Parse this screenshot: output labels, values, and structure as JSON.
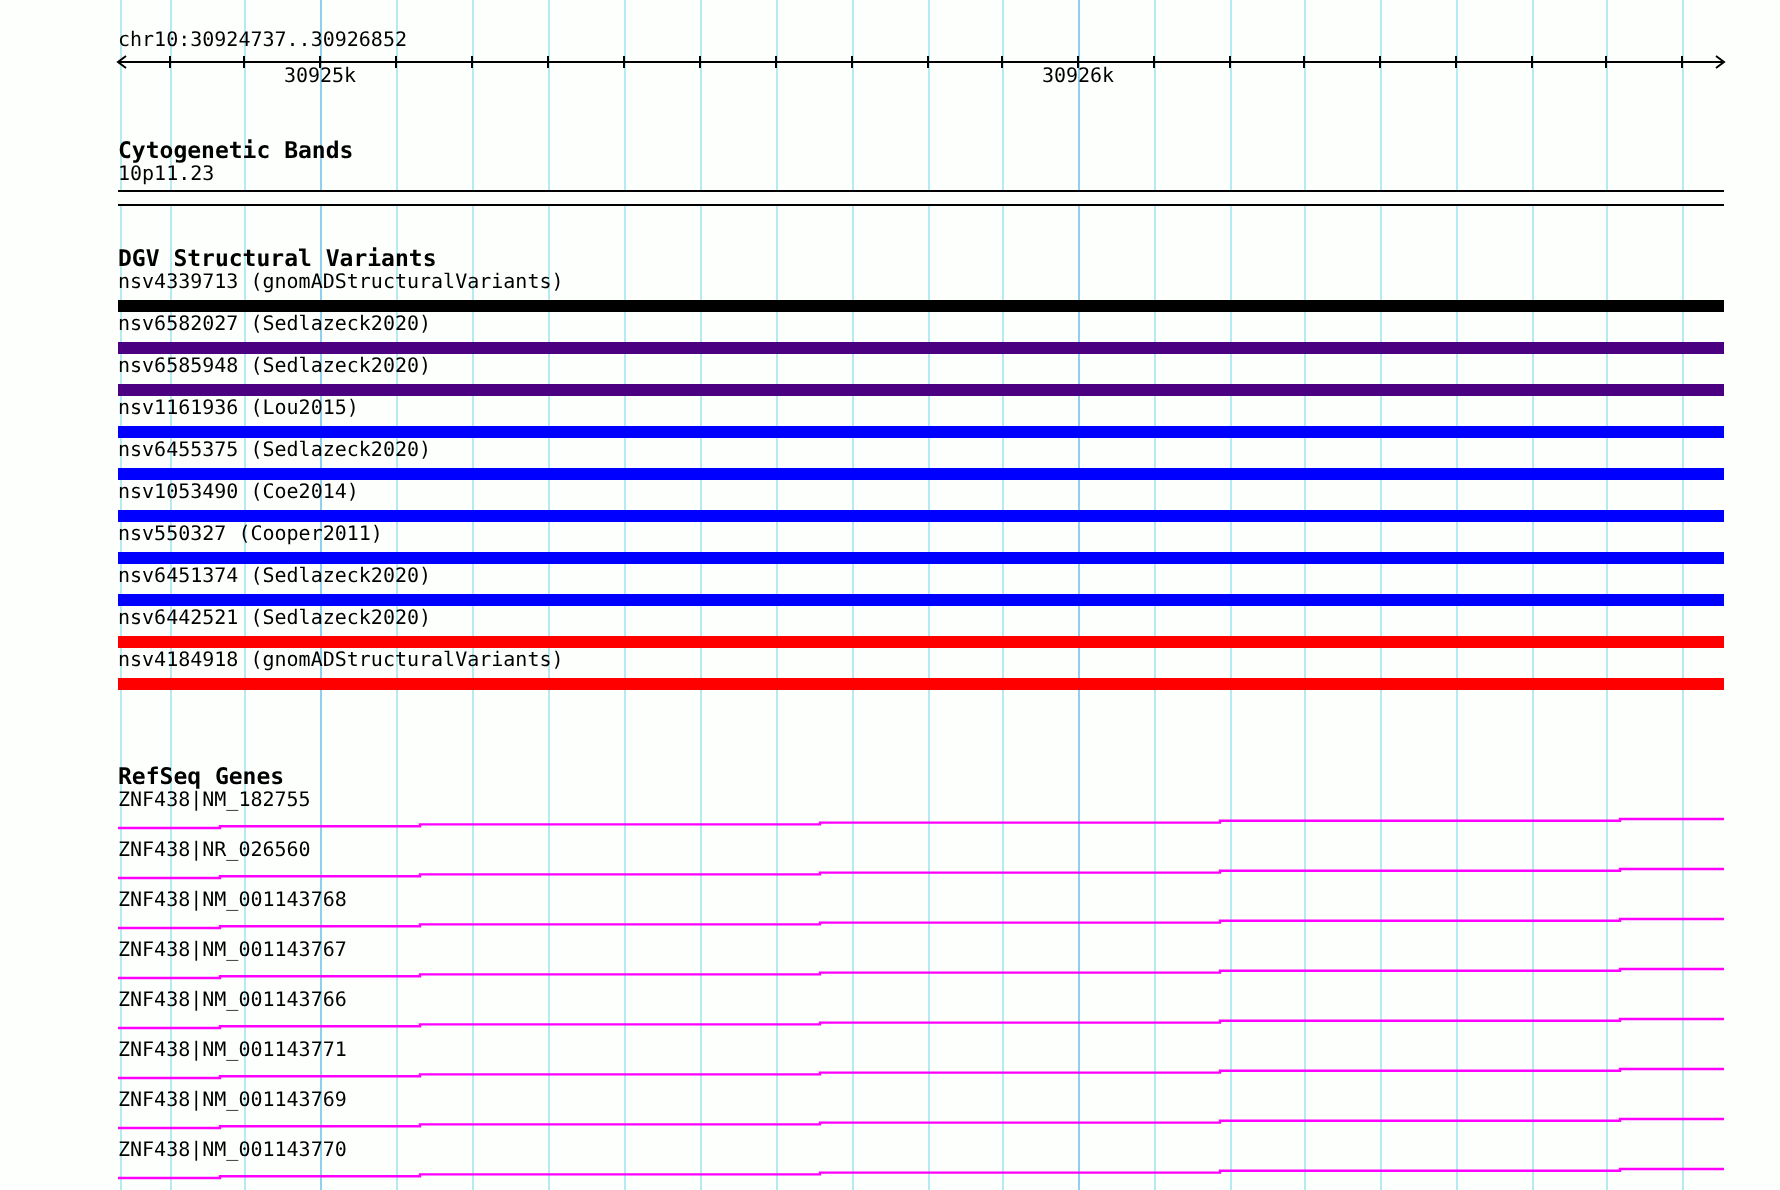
{
  "locus": "chr10:30924737..30926852",
  "ruler": {
    "labels": [
      "30925k",
      "30926k"
    ]
  },
  "tracks": [
    {
      "kind": "band",
      "title": "Cytogenetic Bands",
      "items": [
        {
          "label": "10p11.23"
        }
      ]
    },
    {
      "kind": "variant",
      "title": "DGV Structural Variants",
      "items": [
        {
          "label": "nsv4339713 (gnomADStructuralVariants)",
          "color": "#000000"
        },
        {
          "label": "nsv6582027 (Sedlazeck2020)",
          "color": "#4b0082"
        },
        {
          "label": "nsv6585948 (Sedlazeck2020)",
          "color": "#4b0082"
        },
        {
          "label": "nsv1161936 (Lou2015)",
          "color": "#0000ff"
        },
        {
          "label": "nsv6455375 (Sedlazeck2020)",
          "color": "#0000ff"
        },
        {
          "label": "nsv1053490 (Coe2014)",
          "color": "#0000ff"
        },
        {
          "label": "nsv550327 (Cooper2011)",
          "color": "#0000ff"
        },
        {
          "label": "nsv6451374 (Sedlazeck2020)",
          "color": "#0000ff"
        },
        {
          "label": "nsv6442521 (Sedlazeck2020)",
          "color": "#ff0000"
        },
        {
          "label": "nsv4184918 (gnomADStructuralVariants)",
          "color": "#ff0000"
        }
      ]
    },
    {
      "kind": "gene",
      "title": "RefSeq Genes",
      "items": [
        {
          "label": "ZNF438|NM_182755"
        },
        {
          "label": "ZNF438|NR_026560"
        },
        {
          "label": "ZNF438|NM_001143768"
        },
        {
          "label": "ZNF438|NM_001143767"
        },
        {
          "label": "ZNF438|NM_001143766"
        },
        {
          "label": "ZNF438|NM_001143771"
        },
        {
          "label": "ZNF438|NM_001143769"
        },
        {
          "label": "ZNF438|NM_001143770"
        }
      ]
    }
  ]
}
